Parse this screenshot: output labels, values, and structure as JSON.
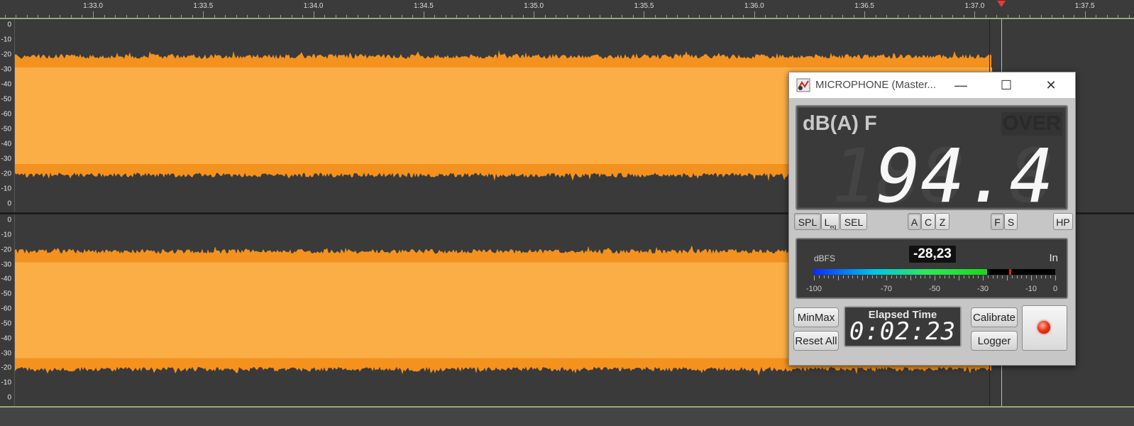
{
  "ruler": {
    "labels": [
      "1:33.0",
      "1:33.5",
      "1:34.0",
      "1:34.5",
      "1:35.0",
      "1:35.5",
      "1:36.0",
      "1:36.5",
      "1:37.0",
      "1:37.5"
    ]
  },
  "tracks": [
    {
      "scale_labels": [
        "0",
        "-10",
        "-20",
        "-30",
        "-40",
        "-50",
        "-60",
        "-50",
        "-40",
        "-30",
        "-20",
        "-10",
        "0"
      ]
    },
    {
      "scale_labels": [
        "0",
        "-10",
        "-20",
        "-30",
        "-40",
        "-50",
        "-60",
        "-50",
        "-40",
        "-30",
        "-20",
        "-10",
        "0"
      ]
    }
  ],
  "colors": {
    "waveform_outer": "#f3921f",
    "waveform_inner": "#fbae45",
    "track_bg": "#3a3a3a",
    "playhead": "#e83a3a"
  },
  "meter_window": {
    "title": "MICROPHONE (Master...",
    "app_icon": "sound-level-meter-icon",
    "window_buttons": {
      "minimize": "—",
      "maximize": "☐",
      "close": "✕"
    },
    "weighting_label": "dB(A) F",
    "over_label": "OVER",
    "level_value": "94.4",
    "mode_buttons": [
      {
        "label": "SPL",
        "active": true
      },
      {
        "label": "L",
        "sub": "eq",
        "active": false
      },
      {
        "label": "SEL",
        "active": false
      }
    ],
    "weighting_buttons": [
      {
        "label": "A",
        "active": true
      },
      {
        "label": "C",
        "active": false
      },
      {
        "label": "Z",
        "active": false
      }
    ],
    "time_buttons": [
      {
        "label": "F",
        "active": true
      },
      {
        "label": "S",
        "active": false
      }
    ],
    "hp_button": "HP",
    "input": {
      "unit_label": "dBFS",
      "value": "-28,23",
      "channel_label": "In",
      "level_dbfs": -28.23,
      "peak_dbfs": -19,
      "scale_labels": [
        "-100",
        "-70",
        "-50",
        "-30",
        "-10",
        "0"
      ]
    },
    "minmax_button": "MinMax",
    "reset_button": "Reset All",
    "elapsed_label": "Elapsed Time",
    "elapsed_value": "0:02:23",
    "calibrate_button": "Calibrate",
    "logger_button": "Logger",
    "record_icon": "record-indicator-icon"
  }
}
